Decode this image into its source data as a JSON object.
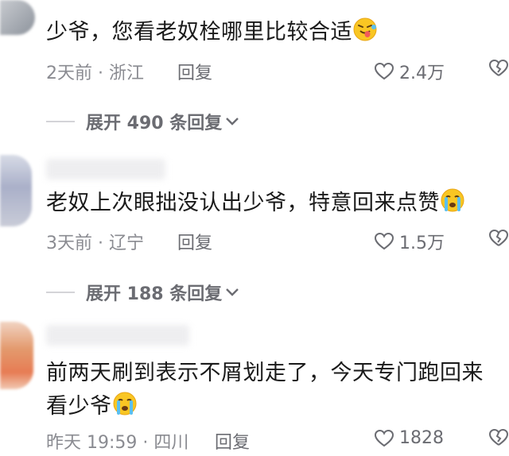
{
  "comments": [
    {
      "text": "少爷，您看老奴栓哪里比较合适",
      "emoji": "tongue-wink-emoji",
      "time_location": "2天前 · 浙江",
      "reply_label": "回复",
      "likes": "2.4万",
      "expand_label": "展开 490 条回复",
      "avatar_color": "#9aa0a8"
    },
    {
      "text": "老奴上次眼拙没认出少爷，特意回来点赞",
      "emoji": "crying-emoji",
      "time_location": "3天前 · 辽宁",
      "reply_label": "回复",
      "likes": "1.5万",
      "expand_label": "展开 188 条回复",
      "avatar_color": "#b7bdd3"
    },
    {
      "text_line1": "前两天刷到表示不屑划走了，今天专门跑回来",
      "text_line2": "看少爷",
      "emoji": "crying-emoji",
      "time_location": "昨天 19:59 · 四川",
      "reply_label": "回复",
      "likes": "1828",
      "avatar_color": "#e08a60"
    }
  ]
}
